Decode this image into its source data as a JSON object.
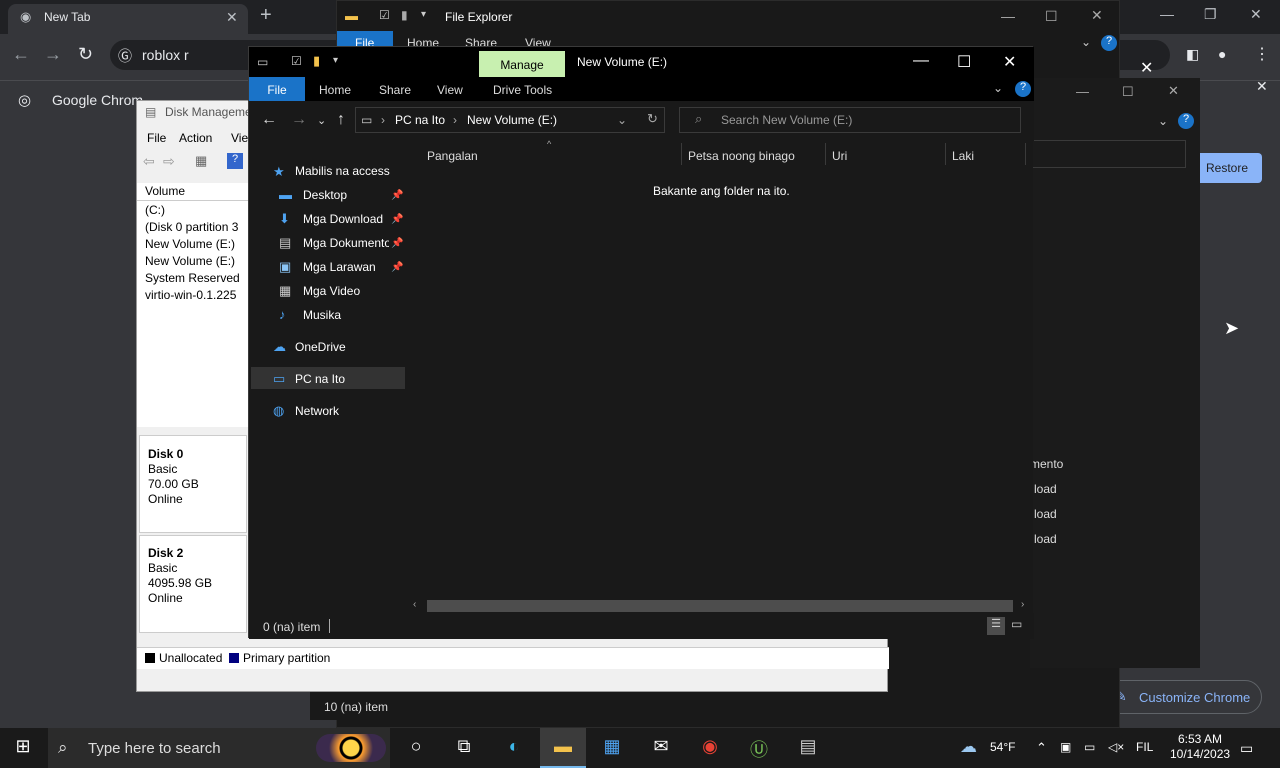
{
  "chrome": {
    "tab_title": "New Tab",
    "tab_close": "✕",
    "new_tab": "+",
    "omnibox_text": "roblox r",
    "bookmark_text": "Google Chrom",
    "restore_label": "Restore",
    "customize_label": "Customize Chrome"
  },
  "back_explorer": {
    "title": "File Explorer",
    "tabs": [
      "File",
      "Home",
      "Share",
      "View"
    ],
    "status": "10 (na) item"
  },
  "disk_management": {
    "title": "Disk Manageme",
    "menu": [
      "File",
      "Action",
      "Vie"
    ],
    "volume_header": "Volume",
    "volumes": [
      "(C:)",
      "(Disk 0 partition 3",
      "New Volume (E:)",
      "New Volume (E:)",
      "System Reserved",
      "virtio-win-0.1.225"
    ],
    "disks": [
      {
        "name": "Disk 0",
        "type": "Basic",
        "size": "70.00 GB",
        "status": "Online"
      },
      {
        "name": "Disk 2",
        "type": "Basic",
        "size": "4095.98 GB",
        "status": "Online"
      }
    ],
    "legend": [
      {
        "label": "Unallocated",
        "color": "#000000"
      },
      {
        "label": "Primary partition",
        "color": "#00007f"
      }
    ],
    "right_items": [
      "mento",
      "load",
      "load",
      "load"
    ]
  },
  "explorer": {
    "manage_tab": "Manage",
    "title": "New Volume (E:)",
    "tabs": {
      "file": "File",
      "home": "Home",
      "share": "Share",
      "view": "View",
      "drive_tools": "Drive Tools"
    },
    "breadcrumb": [
      "PC na Ito",
      "New Volume (E:)"
    ],
    "search_placeholder": "Search New Volume (E:)",
    "nav": {
      "quick_access": "Mabilis na access",
      "items": [
        "Desktop",
        "Mga Download",
        "Mga Dokumento",
        "Mga Larawan",
        "Mga Video",
        "Musika"
      ],
      "onedrive": "OneDrive",
      "pc": "PC na Ito",
      "network": "Network"
    },
    "columns": [
      "Pangalan",
      "Petsa noong binago",
      "Uri",
      "Laki"
    ],
    "empty_message": "Bakante ang folder na ito.",
    "status": "0 (na) item"
  },
  "taskbar": {
    "search_placeholder": "Type here to search",
    "temperature": "54°F",
    "language": "FIL",
    "time": "6:53 AM",
    "date": "10/14/2023"
  }
}
